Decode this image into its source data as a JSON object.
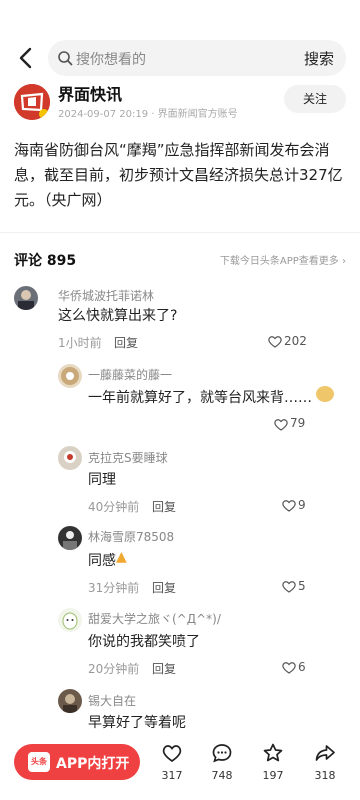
{
  "search": {
    "placeholder": "搜你想看的",
    "button": "搜索"
  },
  "author": {
    "name": "界面快讯",
    "meta": "2024-09-07 20:19 · 界面新闻官方账号",
    "follow": "关注"
  },
  "article": {
    "text": "海南省防御台风“摩羯”应急指挥部新闻发布会消息，截至目前，初步预计文昌经济损失总计327亿元。（央广网）"
  },
  "comments_header": {
    "title": "评论 895",
    "hint": "下载今日头条APP查看更多 ›"
  },
  "comments": [
    {
      "user": "华侨城波托菲诺林",
      "text": "这么快就算出来了?",
      "time": "1小时前",
      "reply": "回复",
      "likes": "202"
    },
    {
      "user": "一藤藤菜的藤一",
      "text": "一年前就算好了，就等台风来背……",
      "likes": "79"
    },
    {
      "user": "克拉克S要睡球",
      "text": "同理",
      "time": "40分钟前",
      "reply": "回复",
      "likes": "9"
    },
    {
      "user": "林海雪原78508",
      "text": "同感",
      "time": "31分钟前",
      "reply": "回复",
      "likes": "5"
    },
    {
      "user": "甜爱大学之旅ヾ(^Д^*)/",
      "text": "你说的我都笑喷了",
      "time": "20分钟前",
      "reply": "回复",
      "likes": "6"
    },
    {
      "user": "锡大自在",
      "text": "早算好了等着呢"
    }
  ],
  "bottom": {
    "app_logo": "头条",
    "app_open": "APP内打开",
    "like_count": "317",
    "comment_count": "748",
    "favorite_count": "197",
    "share_count": "318"
  },
  "colors": {
    "accent": "#f04142",
    "brand_red": "#d13a2a"
  }
}
